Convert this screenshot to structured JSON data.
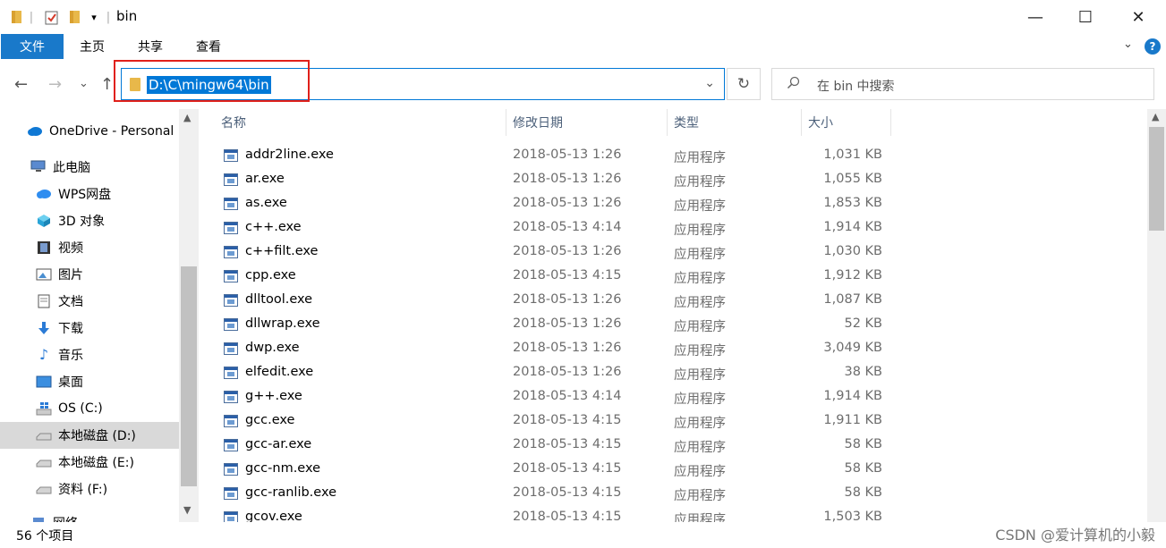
{
  "window": {
    "title": "bin",
    "minimize": "—",
    "maximize": "☐",
    "close": "✕"
  },
  "quick_access": {
    "dropdown": "▾",
    "separator": "|"
  },
  "ribbon": {
    "file": "文件",
    "home": "主页",
    "share": "共享",
    "view": "查看",
    "expand": "⌄",
    "help": "?"
  },
  "nav": {
    "back": "←",
    "forward": "→",
    "recent": "⌄",
    "up": "↑"
  },
  "address": {
    "path": "D:\\C\\mingw64\\bin",
    "dropdown": "⌄"
  },
  "refresh": "↻",
  "search": {
    "placeholder": "在 bin 中搜索",
    "icon": "search-icon"
  },
  "sidebar": {
    "items": [
      {
        "label": "OneDrive - Personal",
        "icon": "cloud-icon"
      },
      {
        "label": "此电脑",
        "icon": "computer-icon"
      },
      {
        "label": "WPS网盘",
        "icon": "wps-cloud-icon"
      },
      {
        "label": "3D 对象",
        "icon": "cube-icon"
      },
      {
        "label": "视频",
        "icon": "video-icon"
      },
      {
        "label": "图片",
        "icon": "picture-icon"
      },
      {
        "label": "文档",
        "icon": "document-icon"
      },
      {
        "label": "下载",
        "icon": "download-icon"
      },
      {
        "label": "音乐",
        "icon": "music-icon"
      },
      {
        "label": "桌面",
        "icon": "desktop-icon"
      },
      {
        "label": "OS (C:)",
        "icon": "windows-drive-icon"
      },
      {
        "label": "本地磁盘 (D:)",
        "icon": "drive-icon",
        "selected": true
      },
      {
        "label": "本地磁盘 (E:)",
        "icon": "drive-icon"
      },
      {
        "label": "资料 (F:)",
        "icon": "drive-icon"
      },
      {
        "label": "网络",
        "icon": "network-icon"
      }
    ],
    "scroll_up": "▲",
    "scroll_down": "▼"
  },
  "columns": {
    "name": "名称",
    "date": "修改日期",
    "type": "类型",
    "size": "大小",
    "sort_indicator": "^"
  },
  "files": [
    {
      "name": "addr2line.exe",
      "date": "2018-05-13 1:26",
      "type": "应用程序",
      "size": "1,031 KB"
    },
    {
      "name": "ar.exe",
      "date": "2018-05-13 1:26",
      "type": "应用程序",
      "size": "1,055 KB"
    },
    {
      "name": "as.exe",
      "date": "2018-05-13 1:26",
      "type": "应用程序",
      "size": "1,853 KB"
    },
    {
      "name": "c++.exe",
      "date": "2018-05-13 4:14",
      "type": "应用程序",
      "size": "1,914 KB"
    },
    {
      "name": "c++filt.exe",
      "date": "2018-05-13 1:26",
      "type": "应用程序",
      "size": "1,030 KB"
    },
    {
      "name": "cpp.exe",
      "date": "2018-05-13 4:15",
      "type": "应用程序",
      "size": "1,912 KB"
    },
    {
      "name": "dlltool.exe",
      "date": "2018-05-13 1:26",
      "type": "应用程序",
      "size": "1,087 KB"
    },
    {
      "name": "dllwrap.exe",
      "date": "2018-05-13 1:26",
      "type": "应用程序",
      "size": "52 KB"
    },
    {
      "name": "dwp.exe",
      "date": "2018-05-13 1:26",
      "type": "应用程序",
      "size": "3,049 KB"
    },
    {
      "name": "elfedit.exe",
      "date": "2018-05-13 1:26",
      "type": "应用程序",
      "size": "38 KB"
    },
    {
      "name": "g++.exe",
      "date": "2018-05-13 4:14",
      "type": "应用程序",
      "size": "1,914 KB"
    },
    {
      "name": "gcc.exe",
      "date": "2018-05-13 4:15",
      "type": "应用程序",
      "size": "1,911 KB"
    },
    {
      "name": "gcc-ar.exe",
      "date": "2018-05-13 4:15",
      "type": "应用程序",
      "size": "58 KB"
    },
    {
      "name": "gcc-nm.exe",
      "date": "2018-05-13 4:15",
      "type": "应用程序",
      "size": "58 KB"
    },
    {
      "name": "gcc-ranlib.exe",
      "date": "2018-05-13 4:15",
      "type": "应用程序",
      "size": "58 KB"
    },
    {
      "name": "gcov.exe",
      "date": "2018-05-13 4:15",
      "type": "应用程序",
      "size": "1,503 KB"
    }
  ],
  "status": {
    "count": "56 个项目"
  },
  "watermark": "CSDN @爱计算机的小毅"
}
